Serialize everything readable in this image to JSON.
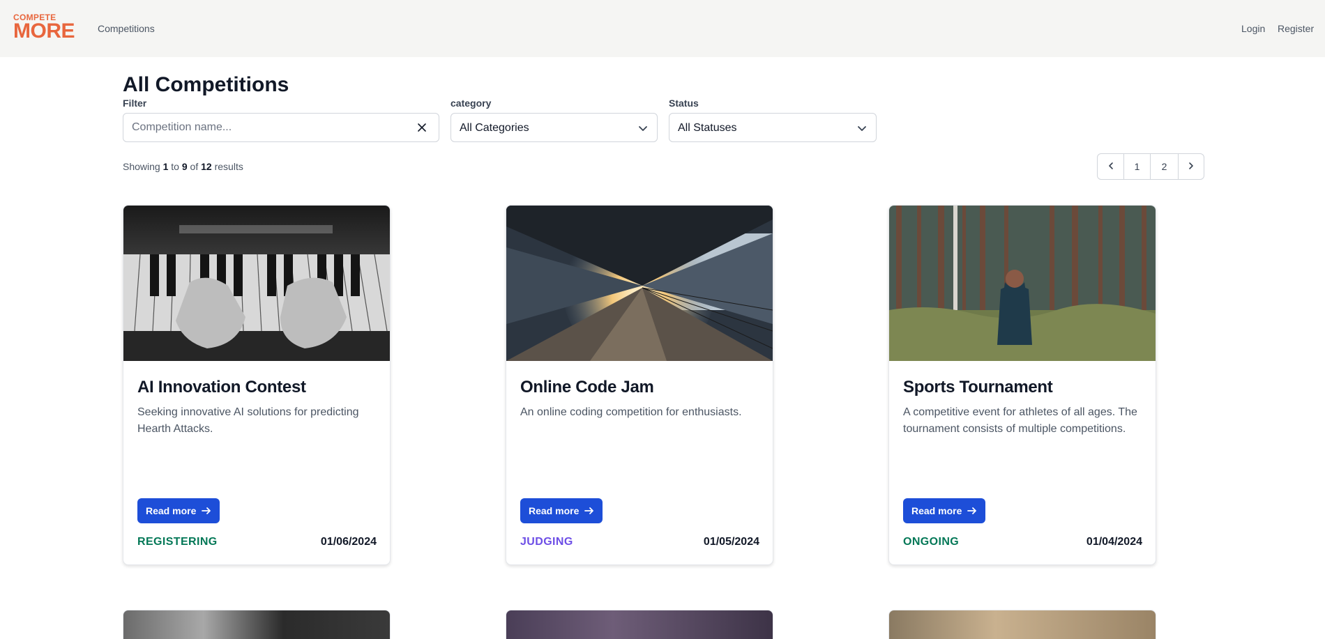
{
  "header": {
    "logo_small": "COMPETE",
    "logo_big": "MORE",
    "nav_competitions": "Competitions",
    "login": "Login",
    "register": "Register"
  },
  "page": {
    "title": "All Competitions"
  },
  "filters": {
    "filter_label": "Filter",
    "filter_placeholder": "Competition name...",
    "filter_value": "",
    "category_label": "category",
    "category_selected": "All Categories",
    "status_label": "Status",
    "status_selected": "All Statuses"
  },
  "results": {
    "prefix": "Showing",
    "from": "1",
    "to_word": "to",
    "to": "9",
    "of_word": "of",
    "total": "12",
    "suffix": "results"
  },
  "pagination": {
    "pages": [
      "1",
      "2"
    ]
  },
  "cards": [
    {
      "title": "AI Innovation Contest",
      "description": "Seeking innovative AI solutions for predicting Hearth Attacks.",
      "button": "Read more",
      "status": "REGISTERING",
      "status_color": "#047857",
      "date": "01/06/2024"
    },
    {
      "title": "Online Code Jam",
      "description": "An online coding competition for enthusiasts.",
      "button": "Read more",
      "status": "JUDGING",
      "status_color": "#6d4ee6",
      "date": "01/05/2024"
    },
    {
      "title": "Sports Tournament",
      "description": "A competitive event for athletes of all ages. The tournament consists of multiple competitions.",
      "button": "Read more",
      "status": "ONGOING",
      "status_color": "#047857",
      "date": "01/04/2024"
    }
  ],
  "colors": {
    "accent": "#e8663d",
    "primary_button": "#1d4ed8",
    "header_bg": "#f5f5f3"
  },
  "icons": {
    "clear": "close-icon",
    "select": "chevron-down-icon",
    "prev": "chevron-left-icon",
    "next": "chevron-right-icon",
    "button_arrow": "arrow-right-icon"
  }
}
